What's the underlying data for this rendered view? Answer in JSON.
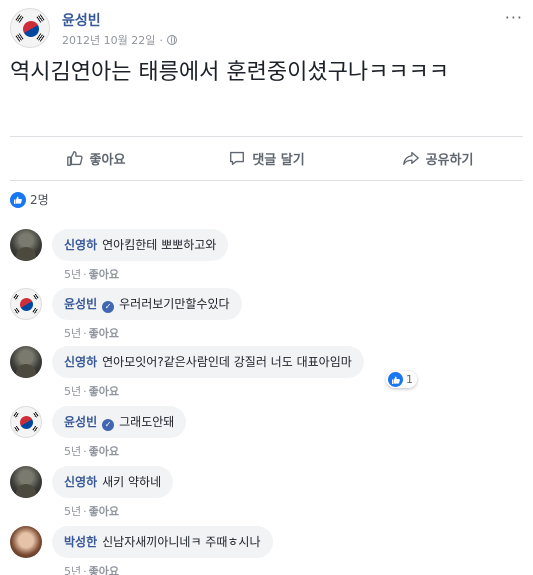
{
  "post": {
    "author": "윤성빈",
    "date": "2012년 10월 22일",
    "separator": "·",
    "more": "···",
    "text": "역시김연아는 태릉에서 훈련중이셨구나ㅋㅋㅋㅋ"
  },
  "actions": {
    "like": "좋아요",
    "comment": "댓글 달기",
    "share": "공유하기"
  },
  "reactions": {
    "count": "2명"
  },
  "comments": [
    {
      "name": "신영하",
      "text": "연아킴한테 뽀뽀하고와",
      "time": "5년",
      "like": "좋아요",
      "avatar": "dark",
      "verified": false
    },
    {
      "name": "윤성빈",
      "text": "우러러보기만할수있다",
      "time": "5년",
      "like": "좋아요",
      "avatar": "flag",
      "verified": true
    },
    {
      "name": "신영하",
      "text": "연아모잇어?같은사람인데 강질러 너도 대표아임마",
      "time": "5년",
      "like": "좋아요",
      "avatar": "dark",
      "verified": false,
      "reaction_count": "1"
    },
    {
      "name": "윤성빈",
      "text": "그래도안돼",
      "time": "5년",
      "like": "좋아요",
      "avatar": "flag",
      "verified": true
    },
    {
      "name": "신영하",
      "text": "새키 약하네",
      "time": "5년",
      "like": "좋아요",
      "avatar": "dark",
      "verified": false
    },
    {
      "name": "박성한",
      "text": "신남자새끼아니네ㅋ 주때ㅎ시나",
      "time": "5년",
      "like": "좋아요",
      "avatar": "photo",
      "verified": false
    }
  ],
  "colors": {
    "link": "#385898",
    "meta": "#90949c",
    "bubble": "#f2f3f5",
    "like_blue": "#1877f2"
  }
}
